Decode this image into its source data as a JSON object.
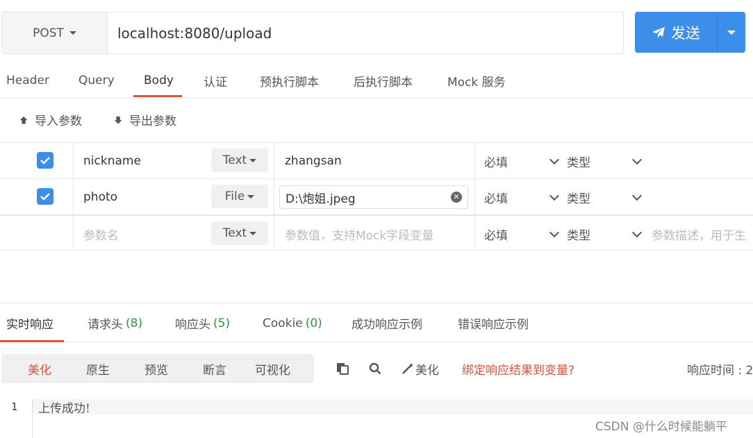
{
  "request": {
    "method": "POST",
    "url": "localhost:8080/upload",
    "send_label": "发送"
  },
  "tabs": [
    {
      "label": "Header"
    },
    {
      "label": "Query"
    },
    {
      "label": "Body"
    },
    {
      "label": "认证"
    },
    {
      "label": "预执行脚本"
    },
    {
      "label": "后执行脚本"
    },
    {
      "label": "Mock 服务"
    }
  ],
  "active_tab": "Body",
  "toolbar": {
    "import_label": "导入参数",
    "export_label": "导出参数"
  },
  "params": [
    {
      "checked": true,
      "name": "nickname",
      "type": "Text",
      "value": "zhangsan",
      "required": "必填",
      "kind": "类型"
    },
    {
      "checked": true,
      "name": "photo",
      "type": "File",
      "value": "D:\\炮姐.jpeg",
      "required": "必填",
      "kind": "类型"
    }
  ],
  "new_param": {
    "name_placeholder": "参数名",
    "type": "Text",
    "value_placeholder": "参数值，支持Mock字段变量",
    "required": "必填",
    "kind": "类型",
    "desc_placeholder": "参数描述，用于生"
  },
  "response_tabs": [
    {
      "label": "实时响应",
      "count": ""
    },
    {
      "label": "请求头",
      "count": "(8)"
    },
    {
      "label": "响应头",
      "count": "(5)"
    },
    {
      "label": "Cookie",
      "count": "(0)"
    },
    {
      "label": "成功响应示例",
      "count": ""
    },
    {
      "label": "错误响应示例",
      "count": ""
    }
  ],
  "view_modes": [
    "美化",
    "原生",
    "预览",
    "断言",
    "可视化"
  ],
  "active_view_mode": "美化",
  "tools": {
    "beautify_label": "美化",
    "bind_label": "绑定响应结果到变量?",
    "response_time_label": "响应时间 : 2"
  },
  "editor": {
    "line_number": "1",
    "content": "上传成功!"
  },
  "watermark": "CSDN @什么时候能躺平",
  "colors": {
    "accent": "#e04e3e",
    "primary": "#3d8ee8",
    "count_green": "#2a9a3c"
  }
}
